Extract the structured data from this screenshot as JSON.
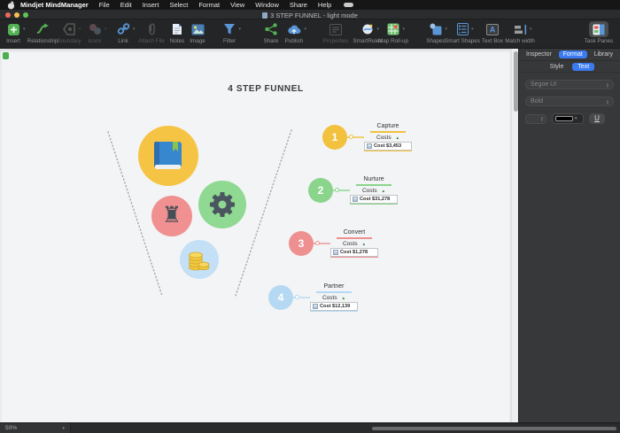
{
  "menubar": {
    "app_name": "Mindjet MindManager",
    "items": [
      "File",
      "Edit",
      "Insert",
      "Select",
      "Format",
      "View",
      "Window",
      "Share",
      "Help"
    ]
  },
  "titlebar": {
    "title": "3 STEP FUNNEL - light mode"
  },
  "toolbar": {
    "items": [
      {
        "label": "Insert",
        "enabled": true
      },
      {
        "label": "Relationship",
        "enabled": true
      },
      {
        "label": "Boundary",
        "enabled": false
      },
      {
        "label": "Icons",
        "enabled": false
      },
      {
        "label": "Link",
        "enabled": true
      },
      {
        "label": "Attach File",
        "enabled": false
      },
      {
        "label": "Notes",
        "enabled": true
      },
      {
        "label": "Image",
        "enabled": true
      },
      {
        "label": "Filter",
        "enabled": true
      },
      {
        "label": "Share",
        "enabled": true
      },
      {
        "label": "Publish",
        "enabled": true
      },
      {
        "label": "Properties",
        "enabled": false
      },
      {
        "label": "SmartRules",
        "enabled": true
      },
      {
        "label": "Map Roll-up",
        "enabled": true
      },
      {
        "label": "Shapes",
        "enabled": true
      },
      {
        "label": "Smart Shapes",
        "enabled": true
      },
      {
        "label": "Text Box",
        "enabled": true
      },
      {
        "label": "Match width",
        "enabled": true
      },
      {
        "label": "Task Panes",
        "enabled": true
      }
    ]
  },
  "panel": {
    "tabs": [
      "Inspector",
      "Format",
      "Library"
    ],
    "active_tab": "Format",
    "subtabs": [
      "Style",
      "Text"
    ],
    "active_subtab": "Text",
    "font_name": "Segoe UI",
    "font_weight": "Bold",
    "underline_button": "U",
    "accent_color": "#3a7bf2"
  },
  "canvas": {
    "title": "4 STEP FUNNEL",
    "rollup_icon": "▲",
    "funnel_circles": [
      {
        "icon": "book",
        "color": "#f6c445"
      },
      {
        "icon": "gear",
        "color": "#8fd992"
      },
      {
        "icon": "rook",
        "color": "#f09090"
      },
      {
        "icon": "coins",
        "color": "#c3e0f6"
      }
    ],
    "steps": [
      {
        "num": "1",
        "name": "Capture",
        "costs_label": "Costs",
        "cost": "Cost $3,453",
        "color": "#f2c13d"
      },
      {
        "num": "2",
        "name": "Nurture",
        "costs_label": "Costs",
        "cost": "Cost $31,278",
        "color": "#8ad48c"
      },
      {
        "num": "3",
        "name": "Convert",
        "costs_label": "Costs",
        "cost": "Cost $1,278",
        "color": "#ef9090"
      },
      {
        "num": "4",
        "name": "Partner",
        "costs_label": "Costs",
        "cost": "Cost $12,139",
        "color": "#b5d9f2"
      }
    ]
  },
  "statusbar": {
    "zoom": "50%"
  }
}
